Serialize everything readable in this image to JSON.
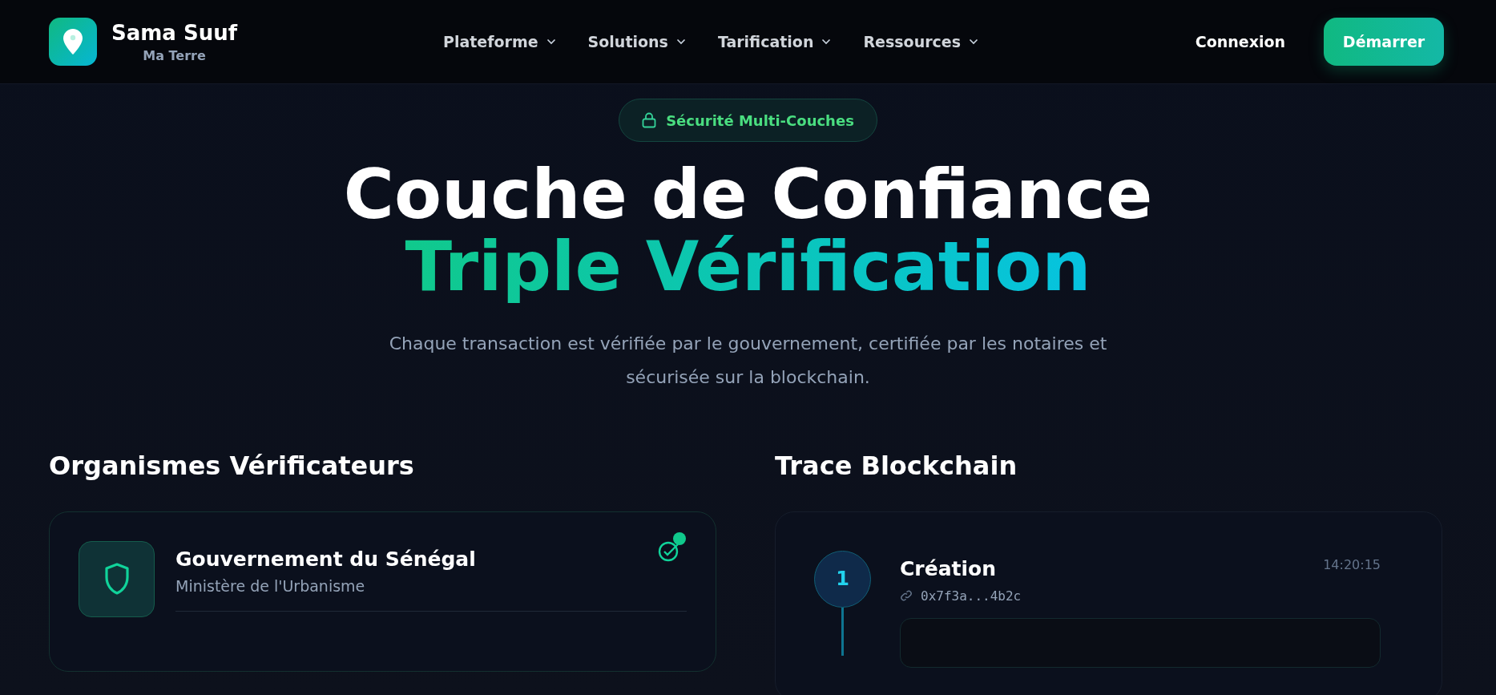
{
  "brand": {
    "name": "Sama Suuf",
    "tagline": "Ma Terre"
  },
  "nav": [
    {
      "label": "Plateforme"
    },
    {
      "label": "Solutions"
    },
    {
      "label": "Tarification"
    },
    {
      "label": "Ressources"
    }
  ],
  "actions": {
    "login": "Connexion",
    "start": "Démarrer"
  },
  "hero": {
    "badge": "Sécurité Multi-Couches",
    "title": "Couche de Confiance",
    "title_accent": "Triple Vérification",
    "subtitle": "Chaque transaction est vérifiée par le gouvernement, certifiée par les notaires et sécurisée sur la blockchain."
  },
  "verifiers": {
    "heading": "Organismes Vérificateurs",
    "items": [
      {
        "name": "Gouvernement du Sénégal",
        "department": "Ministère de l'Urbanisme",
        "verified": true
      }
    ]
  },
  "trace": {
    "heading": "Trace Blockchain",
    "steps": [
      {
        "number": "1",
        "title": "Création",
        "hash": "0x7f3a...4b2c",
        "time": "14:20:15"
      }
    ]
  }
}
